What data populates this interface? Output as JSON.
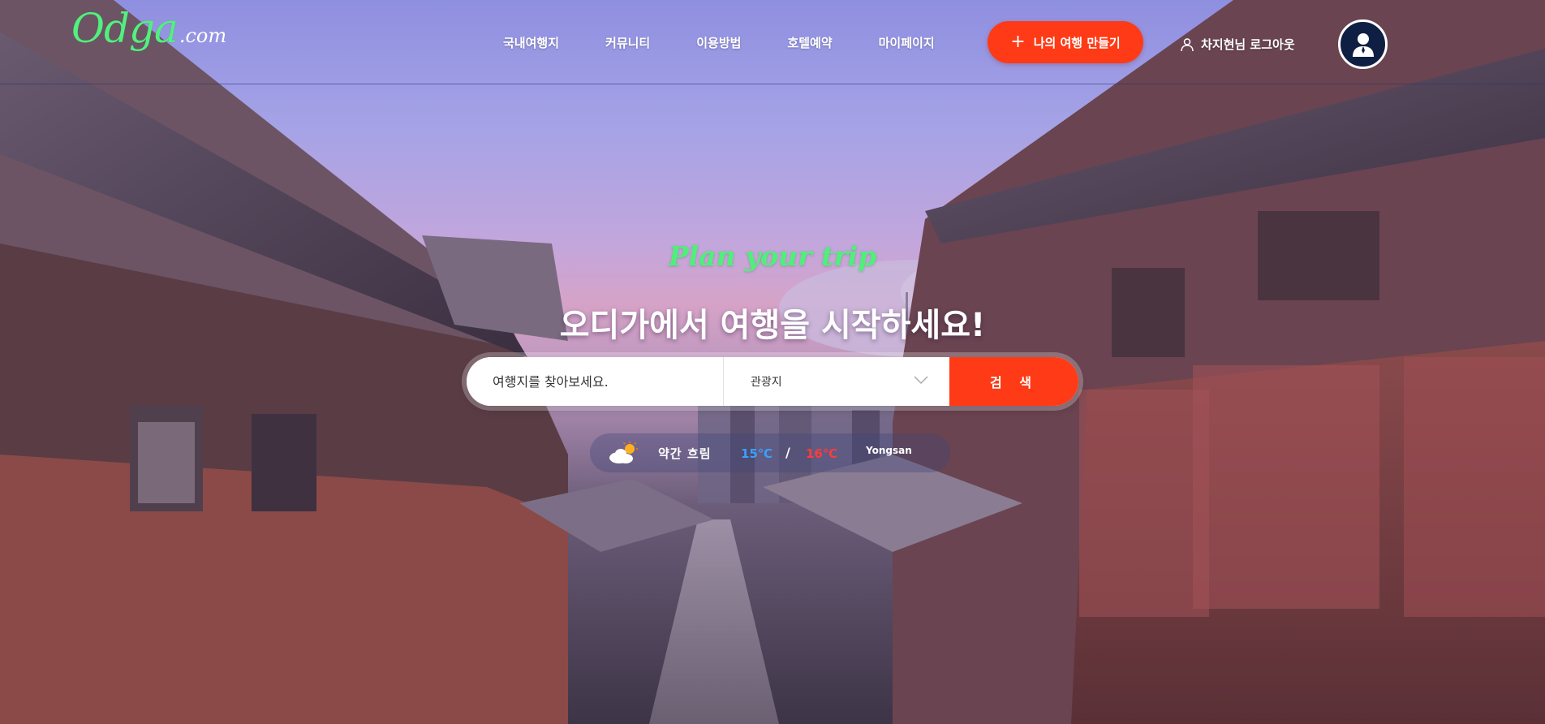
{
  "header": {
    "logo_script": "Odga",
    "logo_suffix": ".com",
    "nav": [
      "국내여행지",
      "커뮤니티",
      "이용방법",
      "호텔예약",
      "마이페이지"
    ],
    "cta_label": "나의 여행 만들기",
    "logout_label": "차지현님 로그아웃"
  },
  "hero": {
    "tagline": "Plan your trip",
    "headline": "오디가에서 여행을 시작하세요!",
    "search": {
      "placeholder": "여행지를 찾아보세요.",
      "category": "관광지",
      "button_label": "검 색"
    },
    "weather": {
      "description": "약간 흐림",
      "low": "15℃",
      "separator": "/",
      "high": "16℃",
      "city": "Yongsan",
      "icon": "partly-cloudy-icon"
    }
  },
  "colors": {
    "accent": "#ff3a16",
    "logo_green": "#52f07e",
    "tagline_green": "#4ff07a",
    "temp_low": "#3ba0ff",
    "temp_high": "#ff3b3b",
    "avatar_bg": "#0f1f44"
  }
}
